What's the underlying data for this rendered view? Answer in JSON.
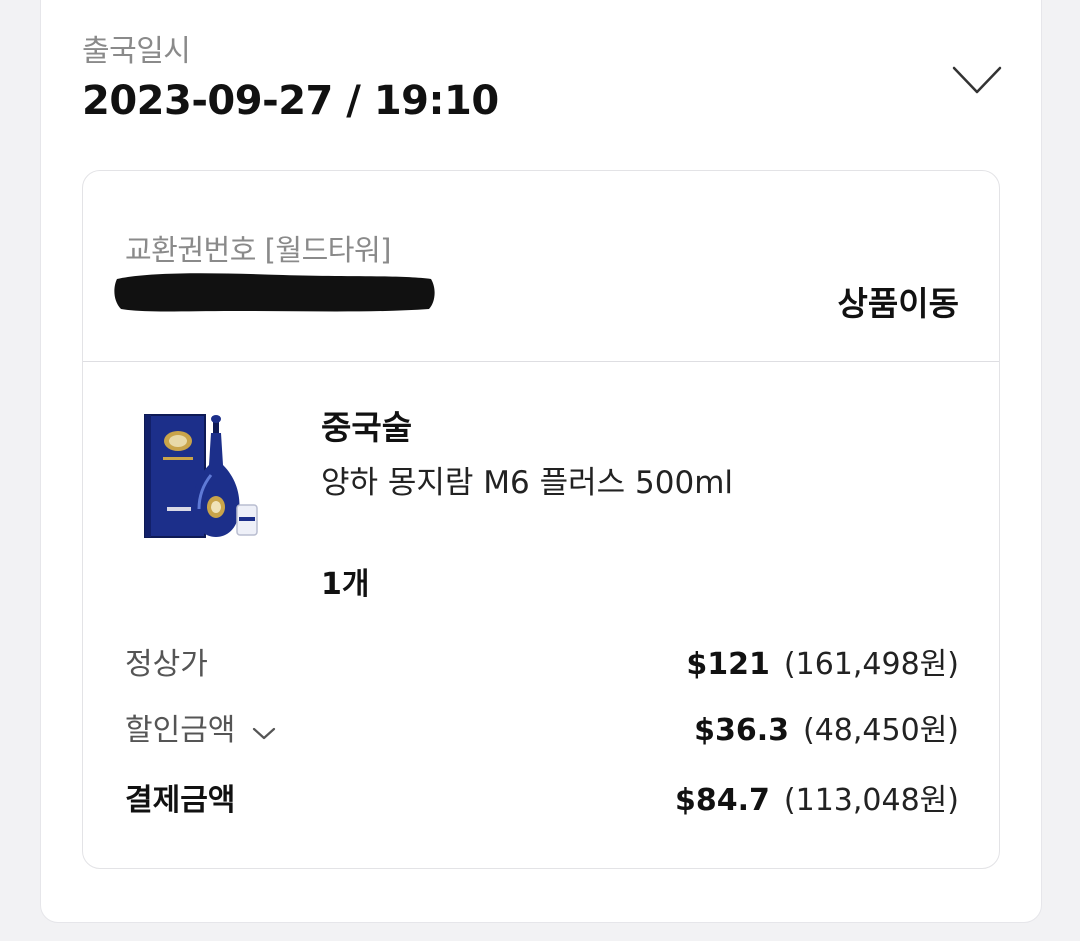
{
  "departure": {
    "label": "출국일시",
    "value": "2023-09-27 / 19:10"
  },
  "voucher": {
    "label": "교환권번호 [월드타워]",
    "move_product": "상품이동"
  },
  "product": {
    "category": "중국술",
    "name": "양하 몽지람 M6 플러스 500ml",
    "quantity": "1개"
  },
  "pricing": {
    "regular": {
      "label": "정상가",
      "usd": "$121",
      "krw": "(161,498원)"
    },
    "discount": {
      "label": "할인금액",
      "usd": "$36.3",
      "krw": "(48,450원)"
    },
    "total": {
      "label": "결제금액",
      "usd": "$84.7",
      "krw": "(113,048원)"
    }
  },
  "icons": {
    "collapse_toggle": "chevron-down-icon",
    "discount_toggle": "chevron-down-icon"
  },
  "colors": {
    "background": "#f2f2f4",
    "card": "#ffffff",
    "muted_text": "#8a8a8a",
    "bottle_blue": "#1c2f8a"
  }
}
